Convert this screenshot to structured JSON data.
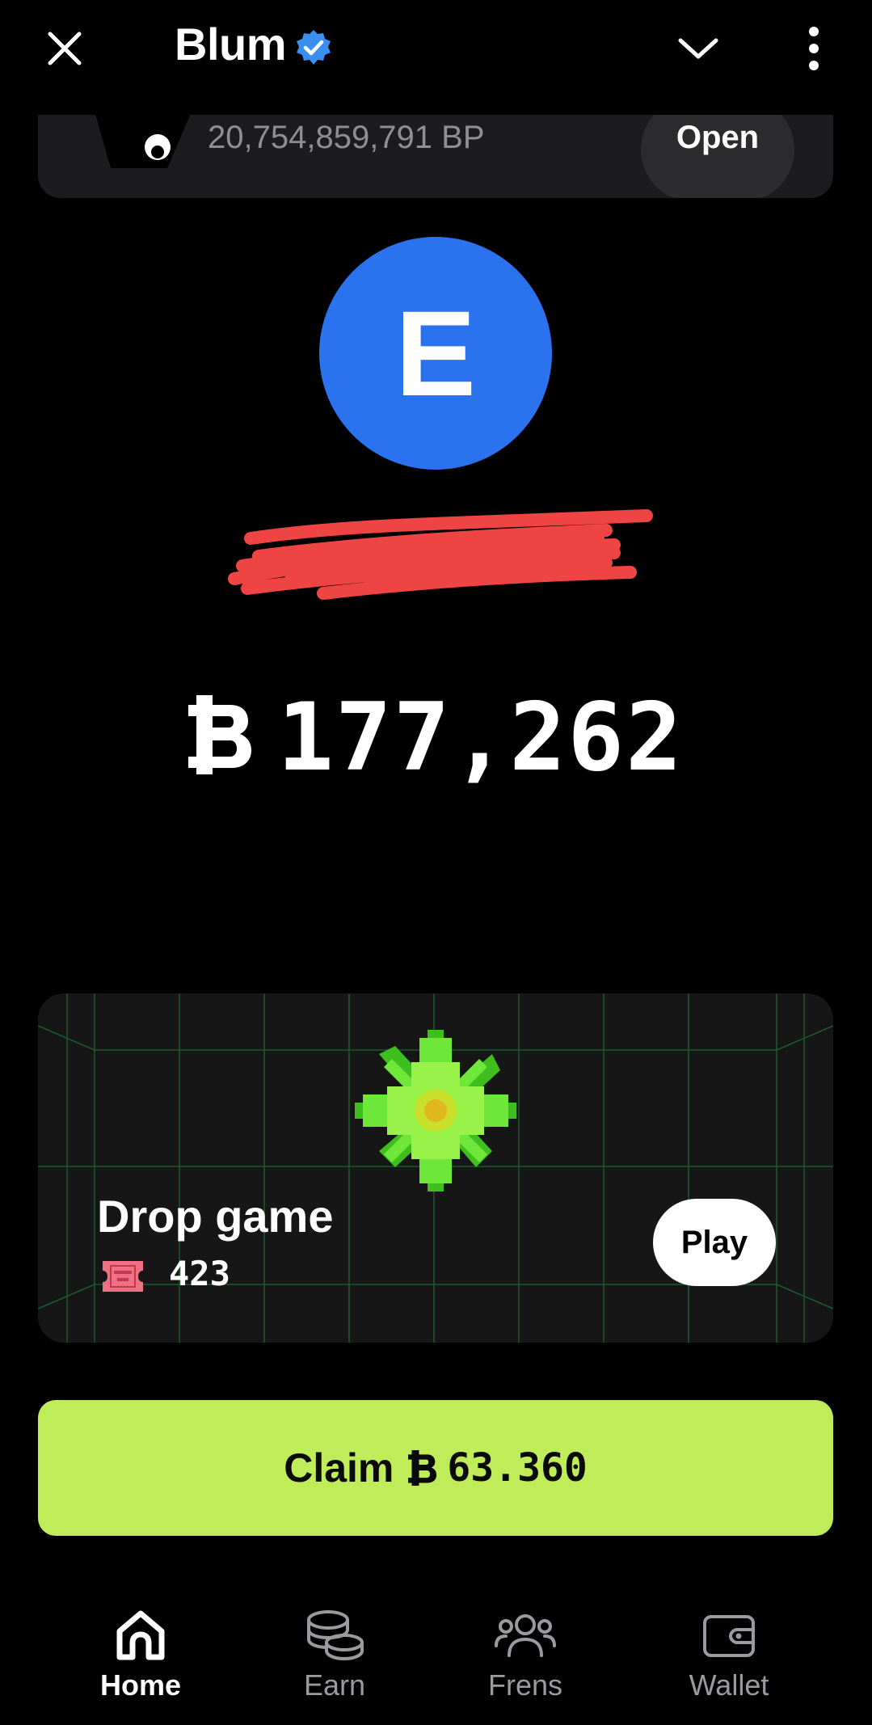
{
  "header": {
    "title": "Blum",
    "close_icon": "close-icon",
    "verified_icon": "verified-badge-icon",
    "chevron_icon": "chevron-down-icon",
    "more_icon": "more-vertical-icon"
  },
  "top_card": {
    "points": "20,754,859,791 BP",
    "open_label": "Open"
  },
  "profile": {
    "avatar_letter": "E",
    "avatar_color": "#2a72ee"
  },
  "balance": {
    "amount": "177,262",
    "currency_icon": "blum-coin-icon"
  },
  "drop_game": {
    "title": "Drop game",
    "tickets": "423",
    "ticket_icon": "ticket-icon",
    "play_label": "Play"
  },
  "claim": {
    "label": "Claim",
    "amount": "63.360",
    "color": "#bfed5a"
  },
  "nav": {
    "items": [
      {
        "label": "Home",
        "icon": "home-icon",
        "active": true
      },
      {
        "label": "Earn",
        "icon": "coins-icon",
        "active": false
      },
      {
        "label": "Frens",
        "icon": "friends-icon",
        "active": false
      },
      {
        "label": "Wallet",
        "icon": "wallet-icon",
        "active": false
      }
    ]
  }
}
